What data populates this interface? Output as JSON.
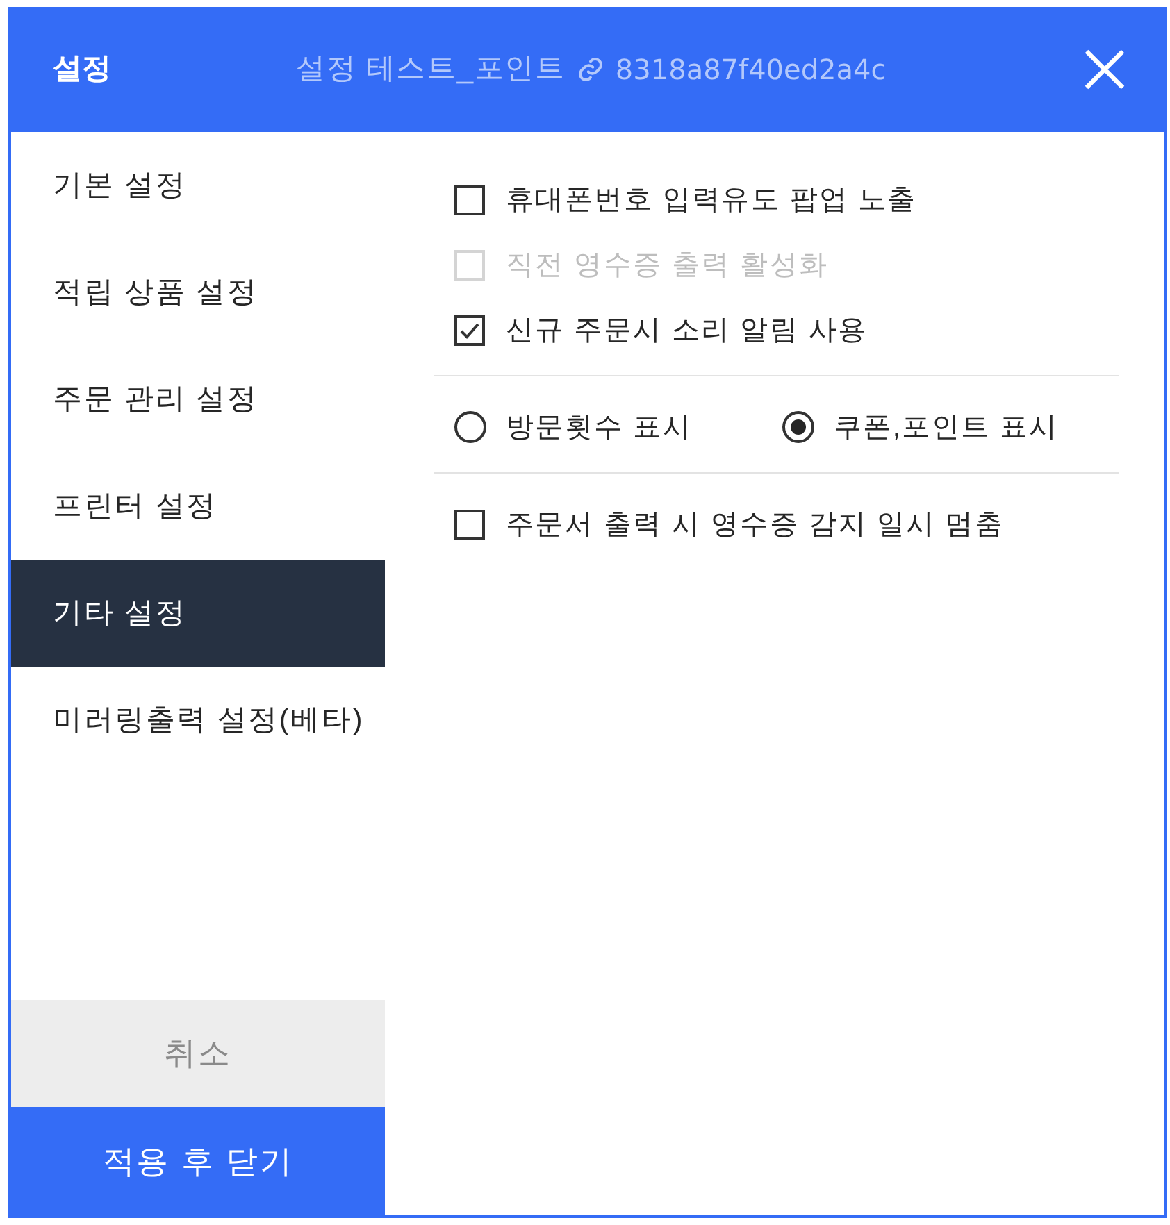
{
  "window": {
    "title": "설정",
    "subtitle": "설정 테스트_포인트",
    "code": "8318a87f40ed2a4c"
  },
  "sidebar": {
    "items": [
      {
        "label": "기본 설정",
        "selected": false
      },
      {
        "label": "적립 상품 설정",
        "selected": false
      },
      {
        "label": "주문 관리 설정",
        "selected": false
      },
      {
        "label": "프린터 설정",
        "selected": false
      },
      {
        "label": "기타 설정",
        "selected": true
      },
      {
        "label": "미러링출력 설정(베타)",
        "selected": false
      }
    ]
  },
  "buttons": [
    {
      "label": "취소",
      "kind": "cancel"
    },
    {
      "label": "적용 후 닫기",
      "kind": "apply"
    }
  ],
  "sections": [
    {
      "kind": "checkboxes",
      "items": [
        {
          "label": "휴대폰번호 입력유도 팝업 노출",
          "checked": false,
          "disabled": false
        },
        {
          "label": "직전 영수증 출력 활성화",
          "checked": false,
          "disabled": true
        },
        {
          "label": "신규 주문시 소리 알림 사용",
          "checked": true,
          "disabled": false
        }
      ]
    },
    {
      "kind": "radios",
      "items": [
        {
          "label": "방문횟수 표시",
          "selected": false
        },
        {
          "label": "쿠폰,포인트 표시",
          "selected": true
        }
      ]
    },
    {
      "kind": "checkboxes",
      "items": [
        {
          "label": "주문서 출력 시 영수증 감지 일시 멈춤",
          "checked": false,
          "disabled": false
        }
      ]
    }
  ]
}
